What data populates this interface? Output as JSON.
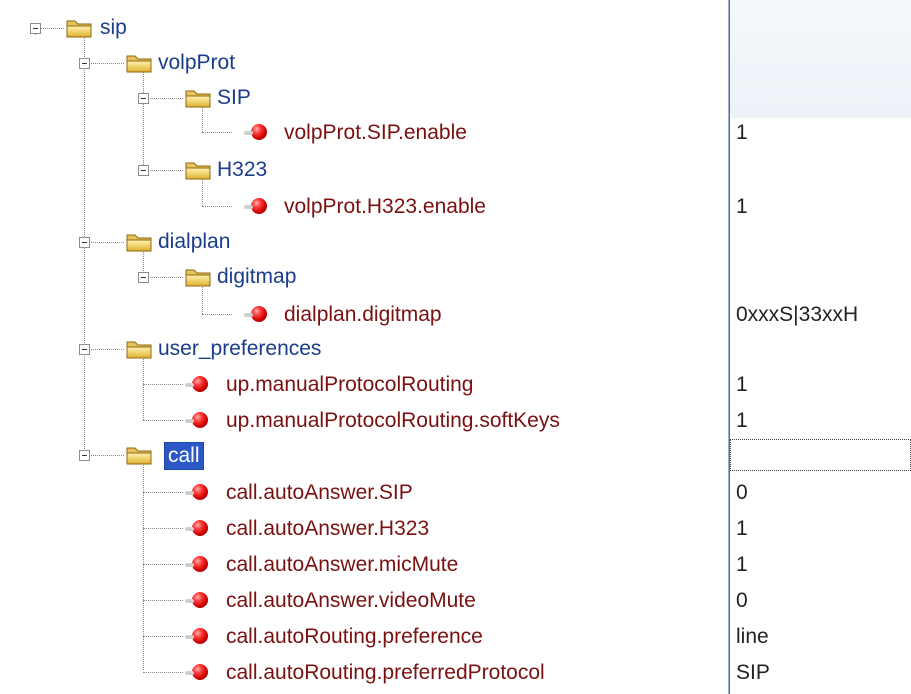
{
  "tree": {
    "root": {
      "label": "sip",
      "icon": "folder-icon",
      "expanded": true
    },
    "folders": [
      {
        "id": "voipProt",
        "label": "volpProt",
        "icon": "folder-icon"
      },
      {
        "id": "sip-sub",
        "label": "SIP",
        "icon": "folder-icon"
      },
      {
        "id": "h323",
        "label": "H323",
        "icon": "folder-icon"
      },
      {
        "id": "dialplan",
        "label": "dialplan",
        "icon": "folder-icon"
      },
      {
        "id": "digitmap",
        "label": "digitmap",
        "icon": "folder-icon"
      },
      {
        "id": "user_preferences",
        "label": "user_preferences",
        "icon": "folder-icon"
      },
      {
        "id": "call",
        "label": "call",
        "icon": "folder-icon",
        "selected": true
      }
    ],
    "leaves": [
      {
        "label": "volpProt.SIP.enable",
        "value": "1",
        "icon": "red-ball-icon"
      },
      {
        "label": "volpProt.H323.enable",
        "value": "1",
        "icon": "red-ball-icon"
      },
      {
        "label": "dialplan.digitmap",
        "value": "0xxxS|33xxH",
        "icon": "red-ball-icon"
      },
      {
        "label": "up.manualProtocolRouting",
        "value": "1",
        "icon": "red-ball-icon"
      },
      {
        "label": "up.manualProtocolRouting.softKeys",
        "value": "1",
        "icon": "red-ball-icon"
      },
      {
        "label": "call.autoAnswer.SIP",
        "value": "0",
        "icon": "red-ball-icon"
      },
      {
        "label": "call.autoAnswer.H323",
        "value": "1",
        "icon": "red-ball-icon"
      },
      {
        "label": "call.autoAnswer.micMute",
        "value": "1",
        "icon": "red-ball-icon"
      },
      {
        "label": "call.autoAnswer.videoMute",
        "value": "0",
        "icon": "red-ball-icon"
      },
      {
        "label": "call.autoRouting.preference",
        "value": "line",
        "icon": "red-ball-icon"
      },
      {
        "label": "call.autoRouting.preferredProtocol",
        "value": "SIP",
        "icon": "red-ball-icon"
      }
    ]
  },
  "colors": {
    "folder_label": "#1a3c8c",
    "leaf_label": "#7a1010",
    "selection": "#2b58c6",
    "divider": "#5a6f90"
  }
}
